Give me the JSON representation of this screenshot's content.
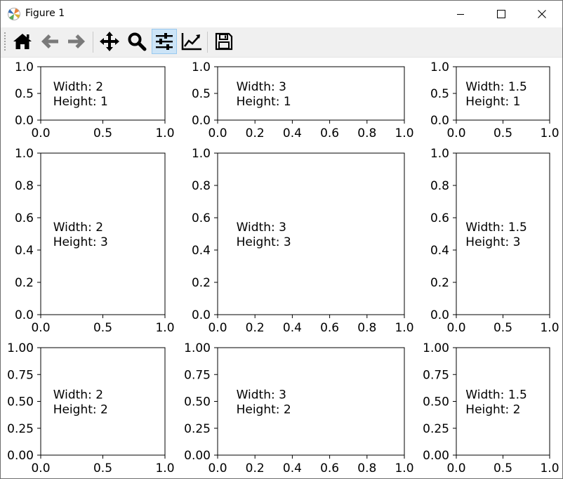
{
  "window": {
    "title": "Figure 1"
  },
  "toolbar": {
    "tools": [
      {
        "name": "home-icon",
        "label": "Home"
      },
      {
        "name": "back-arrow-icon",
        "label": "Back"
      },
      {
        "name": "forward-arrow-icon",
        "label": "Forward"
      },
      {
        "name": "pan-icon",
        "label": "Pan"
      },
      {
        "name": "zoom-icon",
        "label": "Zoom"
      },
      {
        "name": "configure-subplots-icon",
        "label": "Configure subplots",
        "active": true
      },
      {
        "name": "edit-axes-icon",
        "label": "Edit axis"
      },
      {
        "name": "save-icon",
        "label": "Save"
      }
    ],
    "active_color": "#cce4f7"
  },
  "chart_data": [
    {
      "type": "scatter",
      "annotation": [
        "Width: 2",
        "Height: 1"
      ],
      "xlim": [
        0,
        1
      ],
      "ylim": [
        0,
        1
      ],
      "xticks": [
        "0.0",
        "0.5",
        "1.0"
      ],
      "yticks": [
        "0.0",
        "0.5",
        "1.0"
      ]
    },
    {
      "type": "scatter",
      "annotation": [
        "Width: 3",
        "Height: 1"
      ],
      "xlim": [
        0,
        1
      ],
      "ylim": [
        0,
        1
      ],
      "xticks": [
        "0.0",
        "0.2",
        "0.4",
        "0.6",
        "0.8",
        "1.0"
      ],
      "yticks": [
        "0.0",
        "0.5",
        "1.0"
      ]
    },
    {
      "type": "scatter",
      "annotation": [
        "Width: 1.5",
        "Height: 1"
      ],
      "xlim": [
        0,
        1
      ],
      "ylim": [
        0,
        1
      ],
      "xticks": [
        "0.0",
        "0.5",
        "1.0"
      ],
      "yticks": [
        "0.0",
        "0.5",
        "1.0"
      ]
    },
    {
      "type": "scatter",
      "annotation": [
        "Width: 2",
        "Height: 3"
      ],
      "xlim": [
        0,
        1
      ],
      "ylim": [
        0,
        1
      ],
      "xticks": [
        "0.0",
        "0.5",
        "1.0"
      ],
      "yticks": [
        "0.0",
        "0.2",
        "0.4",
        "0.6",
        "0.8",
        "1.0"
      ]
    },
    {
      "type": "scatter",
      "annotation": [
        "Width: 3",
        "Height: 3"
      ],
      "xlim": [
        0,
        1
      ],
      "ylim": [
        0,
        1
      ],
      "xticks": [
        "0.0",
        "0.2",
        "0.4",
        "0.6",
        "0.8",
        "1.0"
      ],
      "yticks": [
        "0.0",
        "0.2",
        "0.4",
        "0.6",
        "0.8",
        "1.0"
      ]
    },
    {
      "type": "scatter",
      "annotation": [
        "Width: 1.5",
        "Height: 3"
      ],
      "xlim": [
        0,
        1
      ],
      "ylim": [
        0,
        1
      ],
      "xticks": [
        "0.0",
        "0.5",
        "1.0"
      ],
      "yticks": [
        "0.0",
        "0.2",
        "0.4",
        "0.6",
        "0.8",
        "1.0"
      ]
    },
    {
      "type": "scatter",
      "annotation": [
        "Width: 2",
        "Height: 2"
      ],
      "xlim": [
        0,
        1
      ],
      "ylim": [
        0,
        1
      ],
      "xticks": [
        "0.0",
        "0.5",
        "1.0"
      ],
      "yticks": [
        "0.00",
        "0.25",
        "0.50",
        "0.75",
        "1.00"
      ]
    },
    {
      "type": "scatter",
      "annotation": [
        "Width: 3",
        "Height: 2"
      ],
      "xlim": [
        0,
        1
      ],
      "ylim": [
        0,
        1
      ],
      "xticks": [
        "0.0",
        "0.2",
        "0.4",
        "0.6",
        "0.8",
        "1.0"
      ],
      "yticks": [
        "0.00",
        "0.25",
        "0.50",
        "0.75",
        "1.00"
      ]
    },
    {
      "type": "scatter",
      "annotation": [
        "Width: 1.5",
        "Height: 2"
      ],
      "xlim": [
        0,
        1
      ],
      "ylim": [
        0,
        1
      ],
      "xticks": [
        "0.0",
        "0.5",
        "1.0"
      ],
      "yticks": [
        "0.00",
        "0.25",
        "0.50",
        "0.75",
        "1.00"
      ]
    }
  ]
}
